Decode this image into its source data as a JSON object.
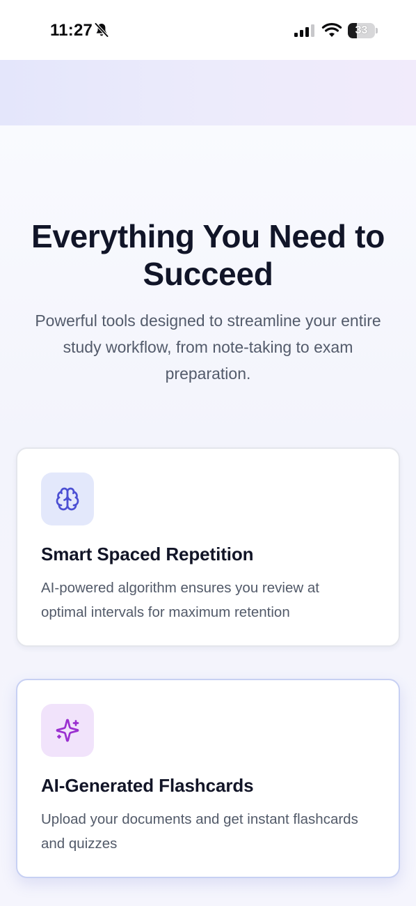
{
  "status_bar": {
    "time": "11:27",
    "battery_level": 33,
    "battery_label": "33",
    "icons": [
      "bell-slash-icon",
      "cellular-signal-icon",
      "wifi-icon",
      "battery-icon"
    ]
  },
  "hero": {
    "title": "Everything You Need to Succeed",
    "subtitle": "Powerful tools designed to streamline your entire study workflow, from note-taking to exam preparation."
  },
  "features": [
    {
      "icon": "brain-icon",
      "title": "Smart Spaced Repetition",
      "description": "AI-powered algorithm ensures you review at optimal intervals for maximum retention"
    },
    {
      "icon": "sparkles-icon",
      "title": "AI-Generated Flashcards",
      "description": "Upload your documents and get instant flashcards and quizzes"
    }
  ],
  "colors": {
    "title_text": "#111528",
    "body_text": "#535b6b",
    "brain_icon": "#4b4fd3",
    "sparkles_icon": "#9a2fd0",
    "brain_icon_bg": "#e3e8fb",
    "sparkles_icon_bg": "#f1e3fb"
  }
}
